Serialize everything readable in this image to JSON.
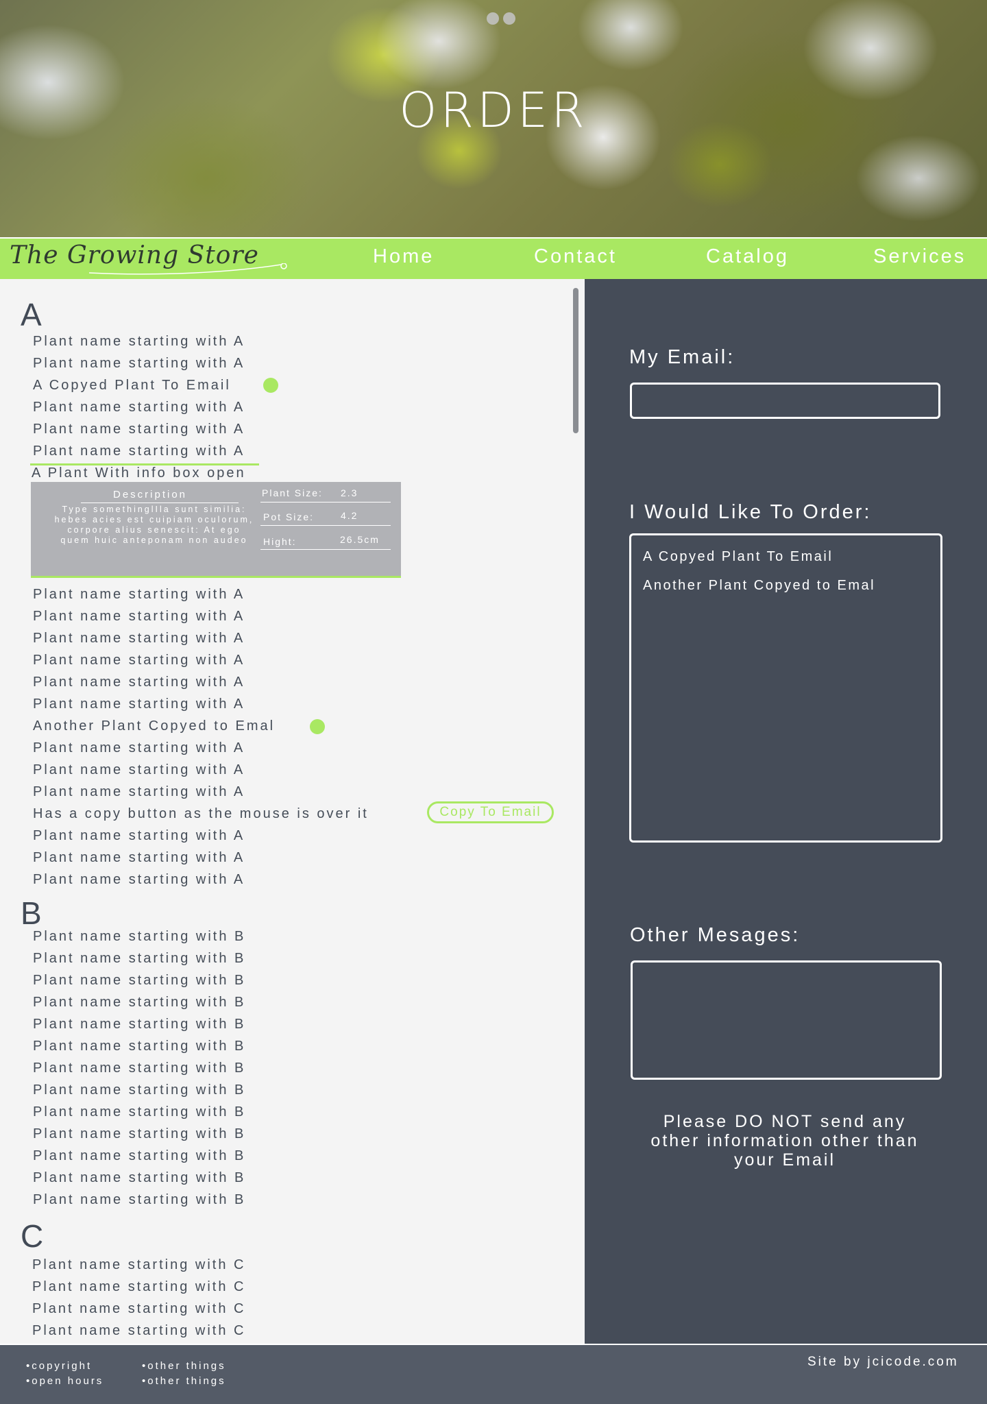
{
  "hero": {
    "title": "ORDER"
  },
  "nav": {
    "brand": "The Growing Store",
    "links": [
      "Home",
      "Contact",
      "Catalog",
      "Services"
    ]
  },
  "list": {
    "sections": [
      {
        "letter": "A",
        "items": [
          "Plant name starting with A",
          "Plant name starting with A",
          "A Copyed Plant To Email",
          "Plant name starting with A",
          "Plant name starting with A",
          "Plant name starting with A",
          "A Plant With info box open",
          "Plant name starting with A",
          "Plant name starting with A",
          "Plant name starting with A",
          "Plant name starting with A",
          "Plant name starting with A",
          "Plant name starting with A",
          "Another Plant Copyed to Emal",
          "Plant name starting with A",
          "Plant name starting with A",
          "Plant name starting with A",
          "Has a copy button as the mouse is over it",
          "Plant name starting with A",
          "Plant name starting with A",
          "Plant name starting with A"
        ]
      },
      {
        "letter": "B",
        "items": [
          "Plant name starting with B",
          "Plant name starting with B",
          "Plant name starting with B",
          "Plant name starting with B",
          "Plant name starting with B",
          "Plant name starting with B",
          "Plant name starting with B",
          "Plant name starting with B",
          "Plant name starting with B",
          "Plant name starting with B",
          "Plant name starting with B",
          "Plant name starting with B",
          "Plant name starting with B"
        ]
      },
      {
        "letter": "C",
        "items": [
          "Plant name starting with C",
          "Plant name starting with C",
          "Plant name starting with C",
          "Plant name starting with C"
        ]
      }
    ],
    "infobox": {
      "description_title": "Description",
      "description_text": "Type somethinglIla sunt similia: hebes acies est cuipiam oculorum, corpore alius senescit: At ego quem huic anteponam non audeo",
      "plant_size_label": "Plant Size:",
      "plant_size_value": "2.3",
      "pot_size_label": "Pot Size:",
      "pot_size_value": "4.2",
      "height_label": "Hight:",
      "height_value": "26.5cm"
    },
    "copy_button_label": "Copy To Email"
  },
  "form": {
    "email_label": "My Email:",
    "email_value": "",
    "order_label": "I Would Like To Order:",
    "order_items": [
      "A Copyed Plant To Email",
      "Another Plant Copyed to Emal"
    ],
    "messages_label": "Other Mesages:",
    "messages_value": "",
    "warning": "Please DO NOT send any other information other than your Email"
  },
  "footer": {
    "col1": [
      "•copyright",
      "•open hours"
    ],
    "col2": [
      "•other things",
      "•other things"
    ],
    "credit": "Site by jcicode.com"
  },
  "colors": {
    "accent_green": "#a9e862",
    "dark_panel": "#454c58",
    "footer": "#545b67",
    "list_bg": "#f4f4f4",
    "infobox": "#b1b2b6"
  },
  "icons": [
    "leaf-swash-icon"
  ]
}
